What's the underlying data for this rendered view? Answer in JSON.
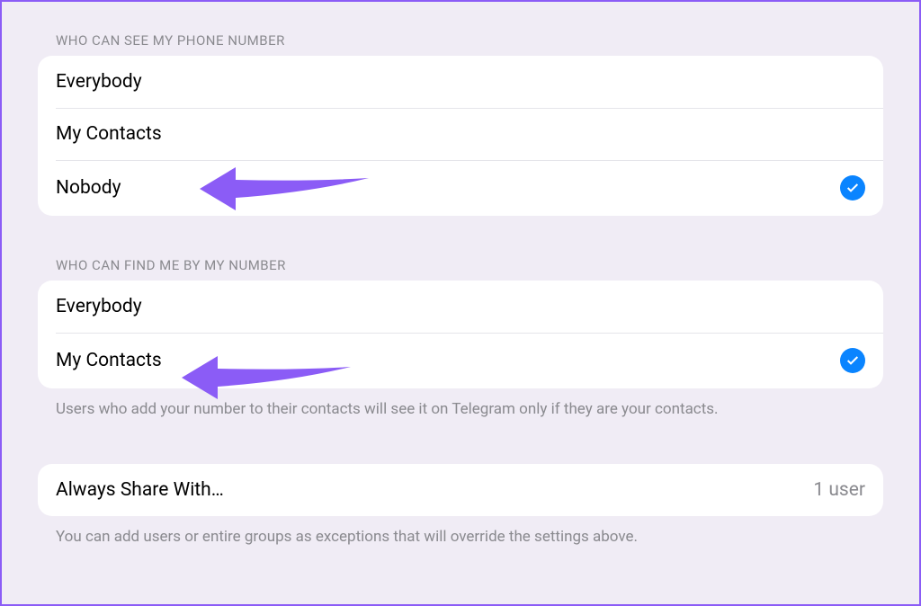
{
  "section1": {
    "header": "WHO CAN SEE MY PHONE NUMBER",
    "options": [
      {
        "label": "Everybody",
        "selected": false
      },
      {
        "label": "My Contacts",
        "selected": false
      },
      {
        "label": "Nobody",
        "selected": true
      }
    ]
  },
  "section2": {
    "header": "WHO CAN FIND ME BY MY NUMBER",
    "options": [
      {
        "label": "Everybody",
        "selected": false
      },
      {
        "label": "My Contacts",
        "selected": true
      }
    ],
    "footer": "Users who add your number to their contacts will see it on Telegram only if they are your contacts."
  },
  "section3": {
    "row": {
      "label": "Always Share With…",
      "value": "1 user"
    },
    "footer": "You can add users or entire groups as exceptions that will override the settings above."
  }
}
